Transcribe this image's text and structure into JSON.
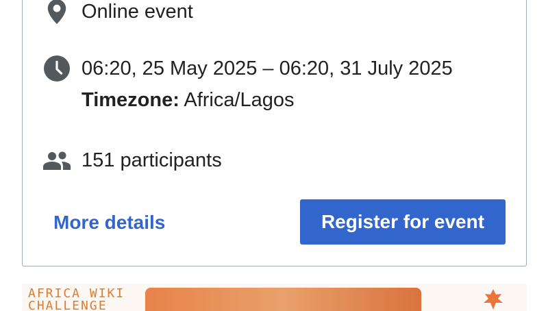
{
  "event": {
    "location": "Online event",
    "datetime": "06:20, 25 May 2025 – 06:20, 31 July 2025",
    "timezone_label": "Timezone:",
    "timezone_value": "Africa/Lagos",
    "participants": "151 participants"
  },
  "actions": {
    "more_details": "More details",
    "register": "Register for event"
  },
  "banner": {
    "text": "AFRICA WIKI\nCHALLENGE"
  },
  "colors": {
    "accent": "#3366cc",
    "icon": "#54595d",
    "border": "#a2a9b1",
    "banner_text": "#e07b2e"
  },
  "icons": {
    "location": "map-pin-icon",
    "time": "clock-icon",
    "participants": "people-icon"
  }
}
